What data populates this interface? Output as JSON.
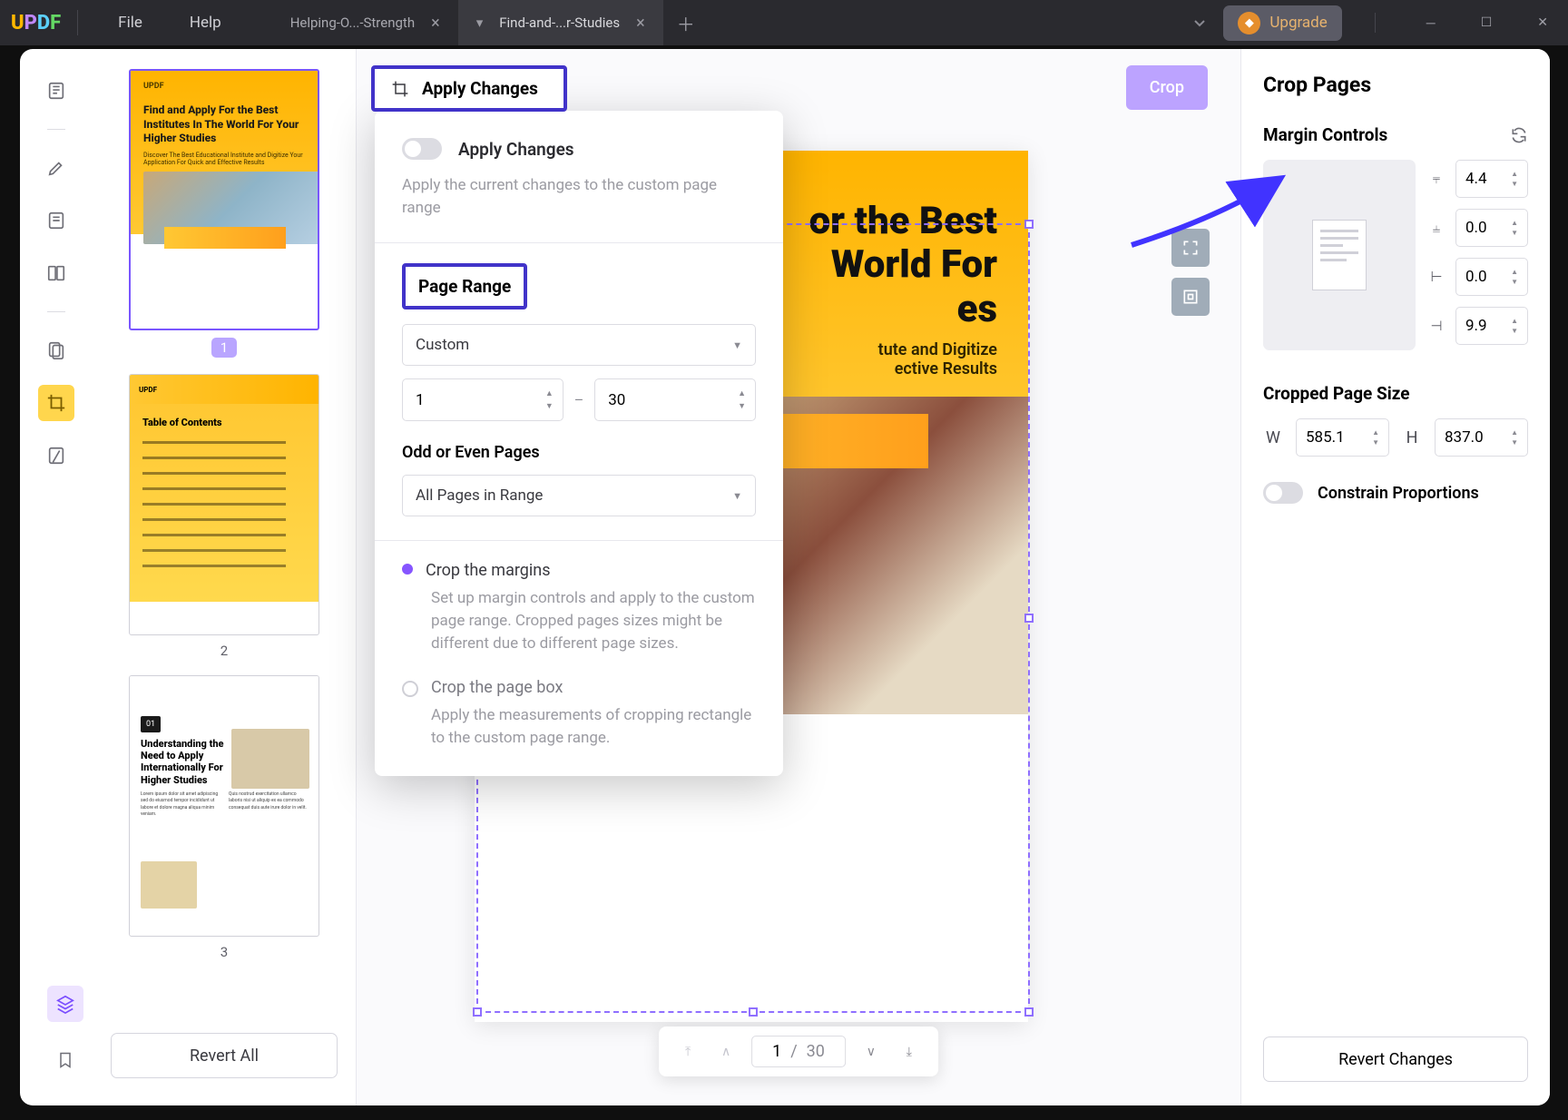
{
  "titlebar": {
    "menu": {
      "file": "File",
      "help": "Help"
    },
    "tabs": [
      {
        "label": "Helping-O...-Strength",
        "active": false
      },
      {
        "label": "Find-and-...r-Studies",
        "active": true
      }
    ],
    "upgrade": "Upgrade"
  },
  "thumbs": {
    "t1_title": "Find and Apply For the Best Institutes In The World For Your Higher Studies",
    "t1_sub": "Discover The Best Educational Institute and Digitize Your Application For Quick and Effective Results",
    "t2_toc": "Table of Contents",
    "t3_badge": "01",
    "t3_title": "Understanding the Need to Apply Internationally For Higher Studies",
    "revert_all": "Revert All"
  },
  "canvas": {
    "apply_changes": "Apply Changes",
    "crop": "Crop",
    "doc_title_line1": "or the Best",
    "doc_title_line2": "World For",
    "doc_title_line3": "es",
    "doc_sub_line1": "tute and Digitize",
    "doc_sub_line2": "ective Results"
  },
  "popover": {
    "apply_title": "Apply Changes",
    "apply_desc": "Apply the current changes to the custom page range",
    "page_range_title": "Page Range",
    "range_select": "Custom",
    "range_from": "1",
    "range_to": "30",
    "odd_even_title": "Odd or Even Pages",
    "odd_even_select": "All Pages in Range",
    "opt1_label": "Crop the margins",
    "opt1_desc": "Set up margin controls and apply to the custom page range. Cropped pages sizes might be different due to different page sizes.",
    "opt2_label": "Crop the page box",
    "opt2_desc": "Apply the measurements of cropping rectangle to the custom page range."
  },
  "pager": {
    "current": "1",
    "total": "30",
    "sep": "/"
  },
  "right": {
    "title": "Crop Pages",
    "margin_title": "Margin Controls",
    "m_top": "4.4",
    "m_bottom": "0.0",
    "m_left": "0.0",
    "m_right": "9.9",
    "size_title": "Cropped Page Size",
    "w_label": "W",
    "w_val": "585.1",
    "h_label": "H",
    "h_val": "837.0",
    "constrain": "Constrain Proportions",
    "revert": "Revert Changes"
  }
}
